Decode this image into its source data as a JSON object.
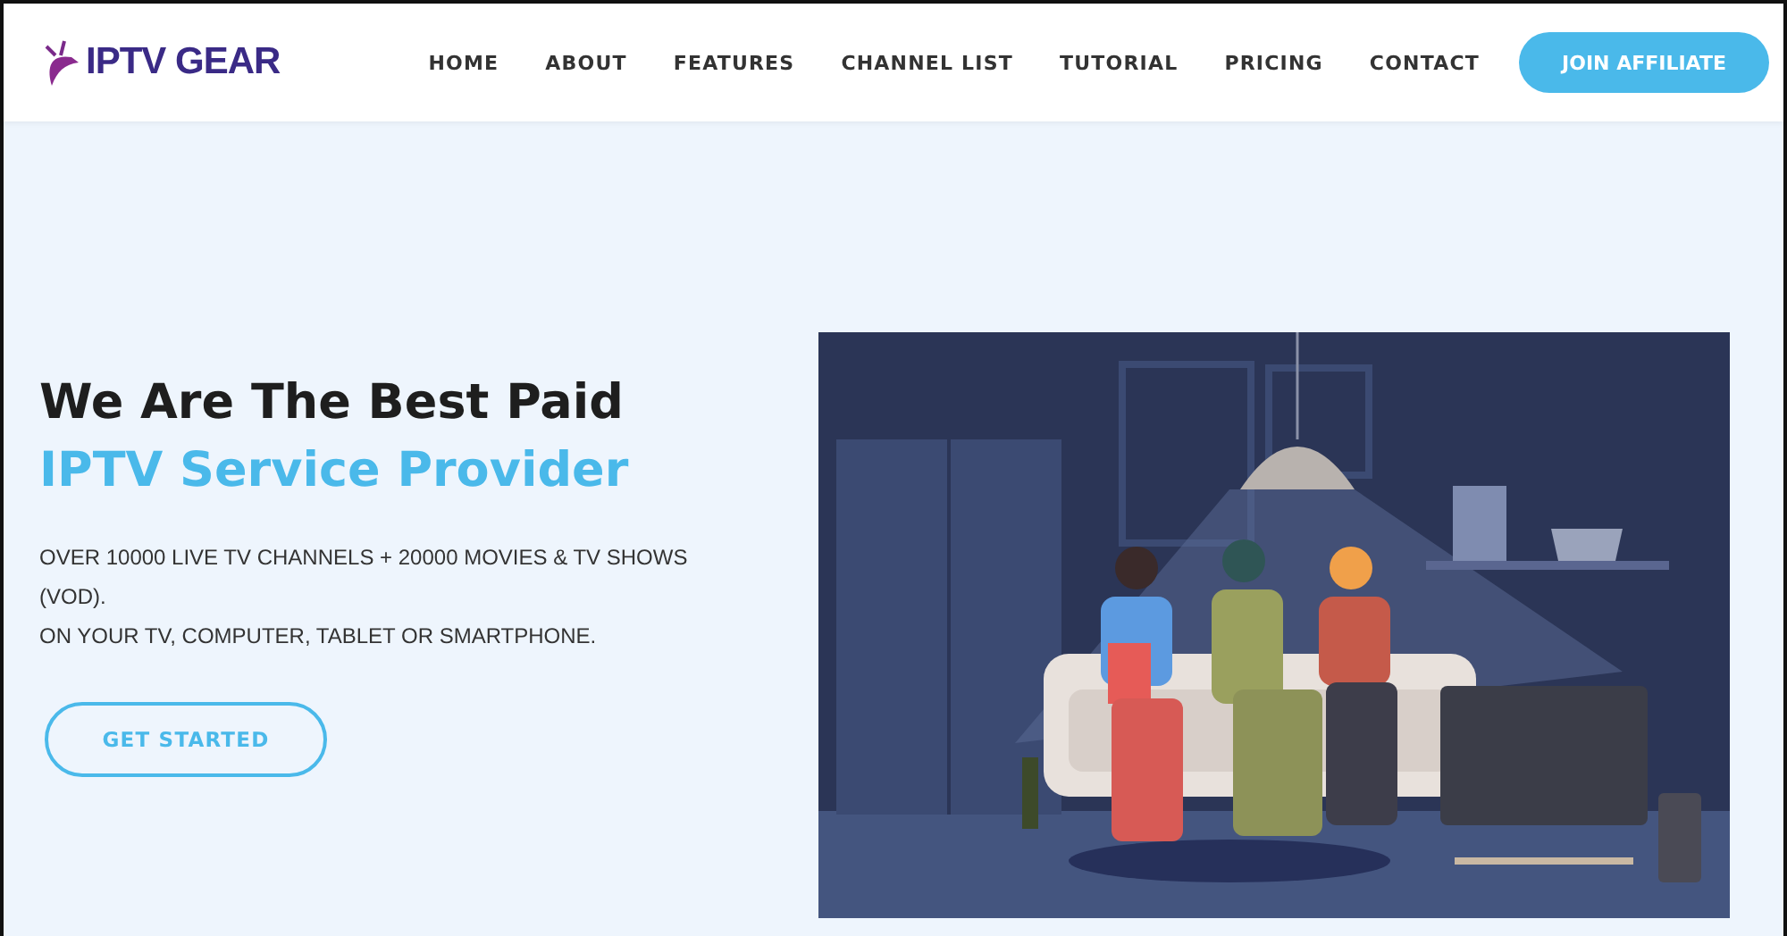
{
  "header": {
    "logo": "IPTV GEAR",
    "nav": [
      "HOME",
      "ABOUT",
      "FEATURES",
      "CHANNEL LIST",
      "TUTORIAL",
      "PRICING",
      "CONTACT"
    ],
    "cta": "JOIN AFFILIATE"
  },
  "hero": {
    "title_line_1": "We Are The Best Paid",
    "title_line_2": "IPTV Service Provider",
    "paragraphs": [
      "OVER 10000 LIVE TV CHANNELS + 20000 MOVIES & TV SHOWS (VOD).",
      "ON YOUR TV, COMPUTER, TABLET OR SMARTPHONE."
    ],
    "button": "GET STARTED"
  }
}
